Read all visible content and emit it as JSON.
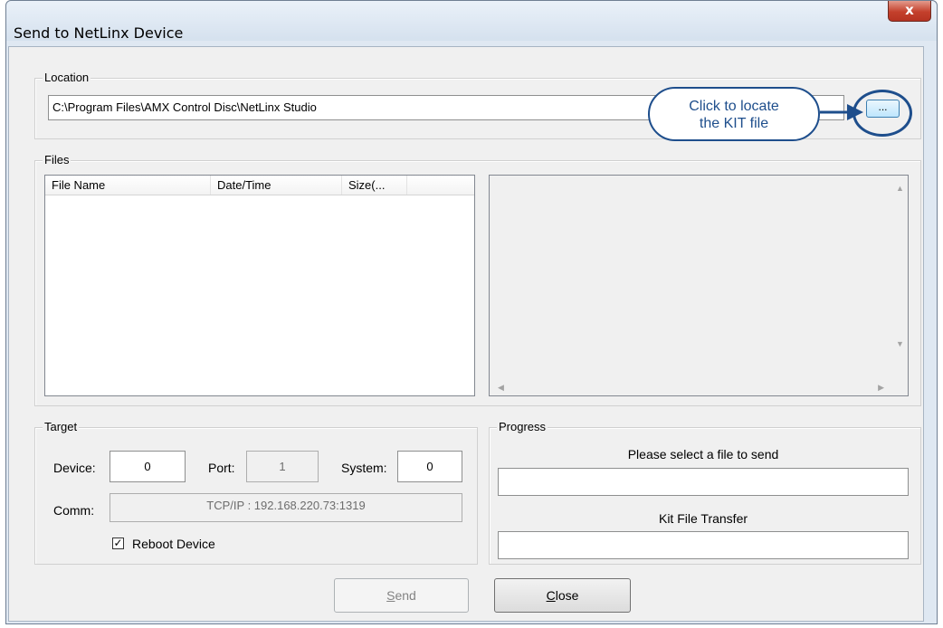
{
  "window": {
    "title": "Send to NetLinx Device",
    "close_glyph": "x"
  },
  "location": {
    "group_label": "Location",
    "path": "C:\\Program Files\\AMX Control Disc\\NetLinx Studio",
    "browse_label": "...",
    "callout_line1": "Click to locate",
    "callout_line2": "the KIT file"
  },
  "files": {
    "group_label": "Files",
    "columns": [
      "File Name",
      "Date/Time",
      "Size(..."
    ]
  },
  "target": {
    "group_label": "Target",
    "device_label": "Device:",
    "device_value": "0",
    "port_label": "Port:",
    "port_value": "1",
    "system_label": "System:",
    "system_value": "0",
    "comm_label": "Comm:",
    "comm_value": "TCP/IP : 192.168.220.73:1319",
    "reboot_label": "Reboot Device",
    "reboot_checked": true
  },
  "progress": {
    "group_label": "Progress",
    "status1": "Please select a file to send",
    "status2": "Kit File Transfer"
  },
  "buttons": {
    "send_label": "Send",
    "send_mnemonic": "S",
    "send_rest": "end",
    "close_label": "Close",
    "close_mnemonic": "C",
    "close_rest": "lose"
  },
  "colors": {
    "accent": "#1e4e8c",
    "close_button": "#c4402c"
  }
}
